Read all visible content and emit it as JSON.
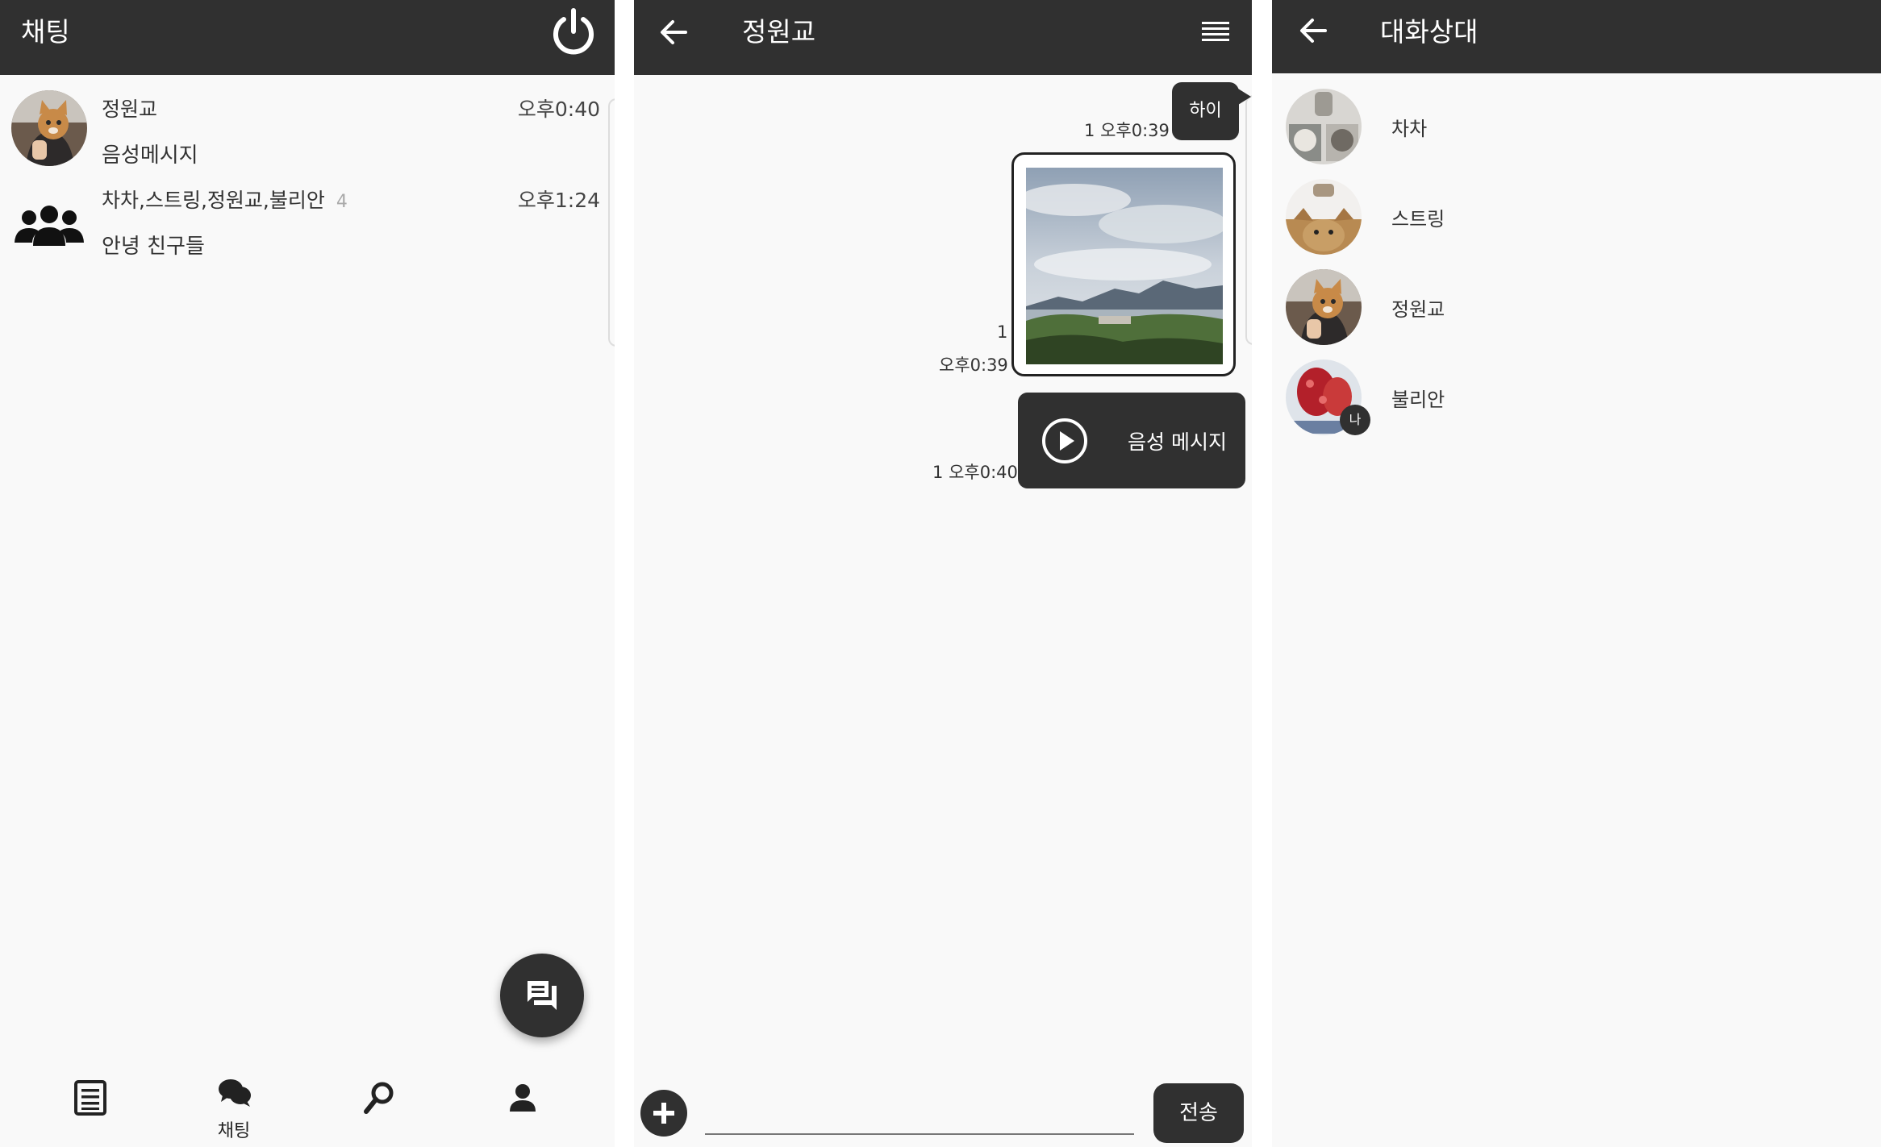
{
  "chat_list": {
    "title": "채팅",
    "items": [
      {
        "name": "정원교",
        "time": "오후0:40",
        "preview": "음성메시지"
      },
      {
        "name": "차차,스트링,정원교,불리안",
        "count": "4",
        "time": "오후1:24",
        "preview": "안녕 친구들"
      }
    ],
    "nav": [
      {
        "icon": "list-icon",
        "label": ""
      },
      {
        "icon": "chat-bubbles-icon",
        "label": "채팅"
      },
      {
        "icon": "search-icon",
        "label": ""
      },
      {
        "icon": "person-icon",
        "label": ""
      }
    ]
  },
  "chat_room": {
    "title": "정원교",
    "messages": [
      {
        "type": "text",
        "text": "하이",
        "unread": "1",
        "time": "오후0:39"
      },
      {
        "type": "image",
        "unread": "1",
        "time": "오후0:39"
      },
      {
        "type": "voice",
        "label": "음성 메시지",
        "unread": "1",
        "time": "오후0:40"
      }
    ],
    "input": {
      "value": "",
      "placeholder": ""
    },
    "send_label": "전송"
  },
  "participants": {
    "title": "대화상대",
    "members": [
      {
        "name": "차차"
      },
      {
        "name": "스트링"
      },
      {
        "name": "정원교"
      },
      {
        "name": "불리안",
        "badge": "나"
      }
    ]
  },
  "colors": {
    "appbar": "#303030",
    "background": "#f9f9f9",
    "accent": "#303030"
  }
}
